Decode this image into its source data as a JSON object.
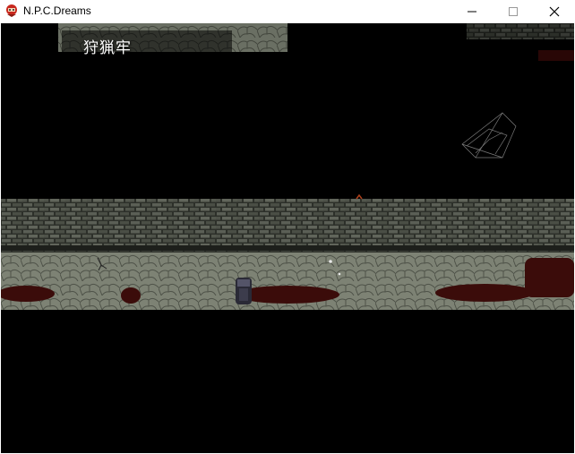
{
  "window": {
    "title": "N.P.C.Dreams",
    "app_icon": "red-character-icon"
  },
  "controls": {
    "minimize_icon": "minimize-icon",
    "maximize_icon": "maximize-icon",
    "close_icon": "close-icon"
  },
  "game": {
    "map_name": "狩猟牢"
  },
  "colors": {
    "titlebar": "#ffffff",
    "background": "#000000",
    "stone_wall": "#4a4f45",
    "cobble_floor": "#8a8f80",
    "blood": "#3a0a08",
    "map_name_text": "#ffffff"
  }
}
